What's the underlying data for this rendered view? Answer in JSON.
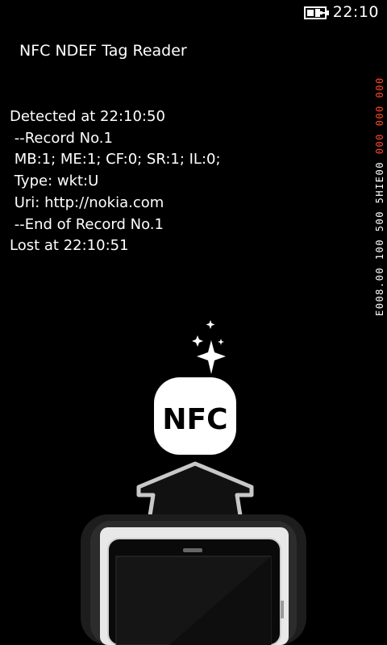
{
  "status_bar": {
    "time": "22:10",
    "battery_icon": "battery-charging-icon"
  },
  "app": {
    "title": "NFC NDEF Tag Reader"
  },
  "log": {
    "lines": [
      "Detected at 22:10:50",
      " --Record No.1",
      " MB:1; ME:1; CF:0; SR:1; IL:0;",
      " Type: wkt:U",
      " Uri: http://nokia.com",
      " --End of Record No.1",
      "Lost at 22:10:51"
    ]
  },
  "debug": {
    "text": "E008.00 100 500 5HIE00 000 000 000",
    "accent_color": "#ff4a2a",
    "color": "#ffffff"
  },
  "illustration": {
    "badge_text": "NFC",
    "sparkle_icon": "sparkles-icon",
    "phone_icon": "phone-icon",
    "connector_icon": "connector-arrow-icon"
  }
}
